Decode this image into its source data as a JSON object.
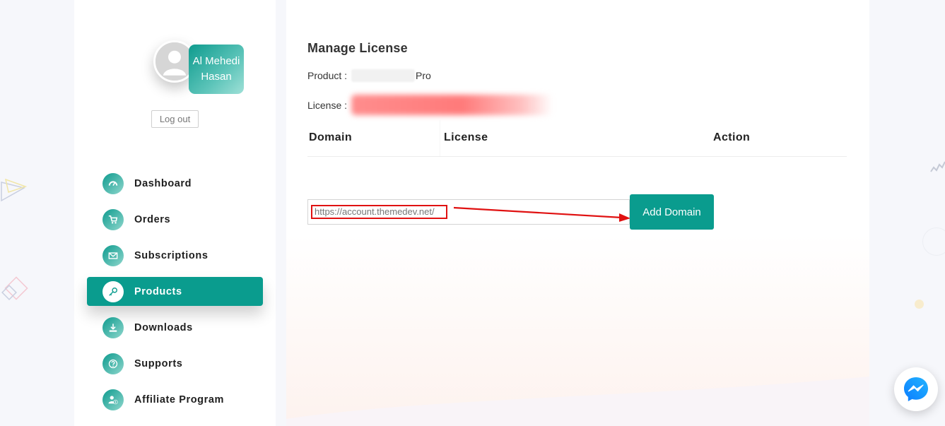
{
  "profile": {
    "name": "Al Mehedi Hasan",
    "logout_label": "Log out"
  },
  "nav": {
    "items": [
      {
        "label": "Dashboard",
        "icon": "dashboard-gauge-icon"
      },
      {
        "label": "Orders",
        "icon": "cart-icon"
      },
      {
        "label": "Subscriptions",
        "icon": "envelope-icon"
      },
      {
        "label": "Products",
        "icon": "key-icon",
        "active": true
      },
      {
        "label": "Downloads",
        "icon": "download-icon"
      },
      {
        "label": "Supports",
        "icon": "question-circle-icon"
      },
      {
        "label": "Affiliate Program",
        "icon": "user-plus-icon"
      }
    ]
  },
  "license_panel": {
    "title": "Manage License",
    "product_label": "Product :",
    "product_suffix": "Pro",
    "license_label": "License :",
    "table_headers": {
      "domain": "Domain",
      "license": "License",
      "action": "Action"
    },
    "domain_input_value": "https://account.themedev.net/",
    "add_button_label": "Add Domain"
  },
  "colors": {
    "accent": "#0a9c8e",
    "annotation_red": "#e01111"
  },
  "widgets": {
    "messenger_icon": "messenger-icon"
  }
}
